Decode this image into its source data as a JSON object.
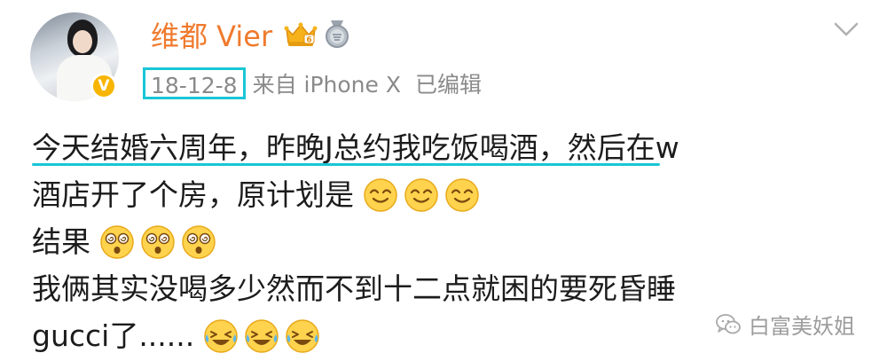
{
  "post": {
    "username": "维都 Vier",
    "date": "18-12-8",
    "source": "来自 iPhone X",
    "edited": "已编辑",
    "verified_badge": "V",
    "lines": [
      "今天结婚六周年，昨晚J总约我吃饭喝酒，然后在w",
      "酒店开了个房，原计划是",
      "结果",
      "我俩其实没喝多少然而不到十二点就困的要死昏睡",
      "gucci了......"
    ],
    "emoji_rows": {
      "line2": [
        "smile-emoji",
        "smile-emoji",
        "smile-emoji"
      ],
      "line3": [
        "dizzy-emoji",
        "dizzy-emoji",
        "dizzy-emoji"
      ],
      "line5": [
        "laugh-cry-emoji",
        "laugh-cry-emoji",
        "laugh-cry-emoji"
      ]
    }
  },
  "watermark": {
    "text": "白富美妖姐"
  },
  "colors": {
    "username": "#f07a2d",
    "highlight": "#18c6d6",
    "meta": "#8a8a8a",
    "badge": "#f7b500"
  }
}
